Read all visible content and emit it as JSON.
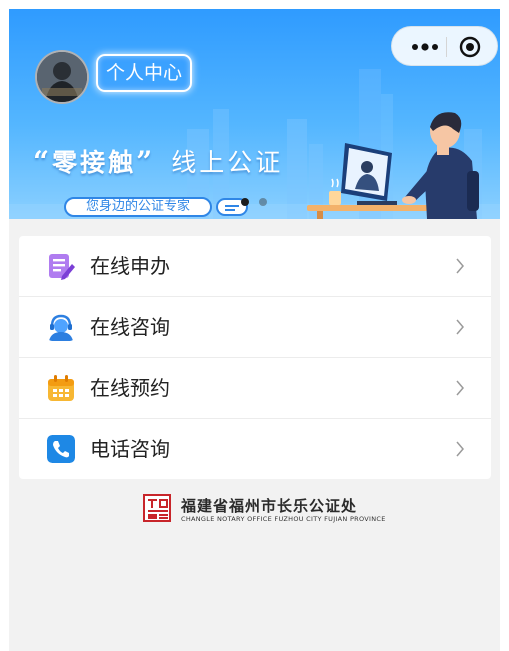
{
  "banner": {
    "user_center_label": "个人中心",
    "slogan_open_quote": "“",
    "slogan_main": "零接触",
    "slogan_close_quote": "”",
    "slogan_rest": "线上公证",
    "expert_tag": "您身边的公证专家",
    "carousel": {
      "total_slides": 2,
      "active_index": 0
    },
    "colors": {
      "top": "#2f9bff",
      "bottom": "#8bd0ff",
      "accent": "#2f86e6"
    }
  },
  "capsule": {
    "more_icon": "more-dots-icon",
    "close_icon": "target-close-icon"
  },
  "menu": {
    "items": [
      {
        "label": "在线申办",
        "icon": "edit-form-icon",
        "color": "#9b5de5"
      },
      {
        "label": "在线咨询",
        "icon": "customer-service-icon",
        "color": "#3a8ef0"
      },
      {
        "label": "在线预约",
        "icon": "calendar-icon",
        "color": "#f5a623"
      },
      {
        "label": "电话咨询",
        "icon": "phone-icon",
        "color": "#1e88e5"
      }
    ],
    "chevron_icon": "chevron-right-icon"
  },
  "footer": {
    "org_name_cn": "福建省福州市长乐公证处",
    "org_name_en": "CHANGLE NOTARY OFFICE FUZHOU CITY FUJIAN PROVINCE",
    "seal_color": "#c8252a"
  }
}
